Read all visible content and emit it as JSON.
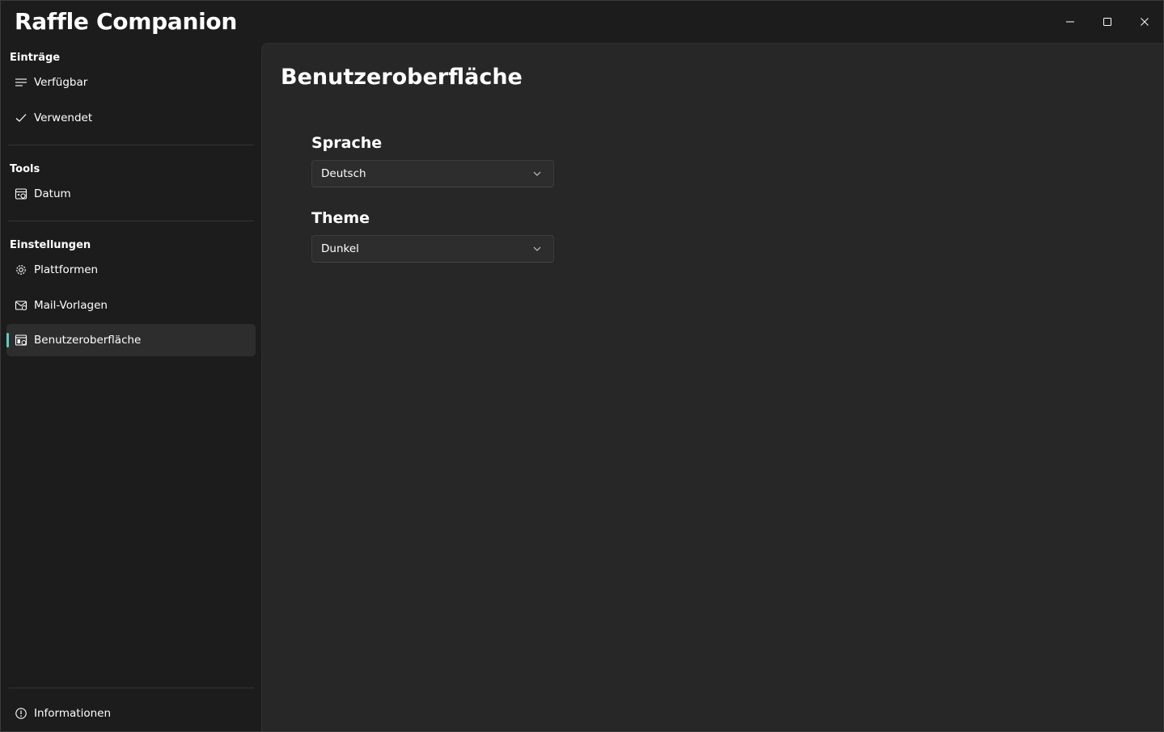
{
  "app": {
    "title": "Raffle Companion"
  },
  "window_controls": {
    "minimize": "minimize-icon",
    "maximize": "maximize-icon",
    "close": "close-icon"
  },
  "sidebar": {
    "sections": [
      {
        "header": "Einträge",
        "items": [
          {
            "label": "Verfügbar",
            "icon": "list-icon"
          },
          {
            "label": "Verwendet",
            "icon": "checkmark-icon"
          }
        ]
      },
      {
        "header": "Tools",
        "items": [
          {
            "label": "Datum",
            "icon": "calendar-icon"
          }
        ]
      },
      {
        "header": "Einstellungen",
        "items": [
          {
            "label": "Plattformen",
            "icon": "gear-icon"
          },
          {
            "label": "Mail-Vorlagen",
            "icon": "mail-settings-icon"
          },
          {
            "label": "Benutzeroberfläche",
            "icon": "ui-settings-icon",
            "selected": true
          }
        ]
      }
    ],
    "footer": {
      "label": "Informationen",
      "icon": "info-icon"
    }
  },
  "main": {
    "title": "Benutzeroberfläche",
    "fields": [
      {
        "label": "Sprache",
        "value": "Deutsch"
      },
      {
        "label": "Theme",
        "value": "Dunkel"
      }
    ]
  },
  "colors": {
    "accent": "#60cdbf",
    "sidebar_bg": "#1c1c1c",
    "content_bg": "#272727",
    "selected_bg": "#2d2d2d"
  }
}
